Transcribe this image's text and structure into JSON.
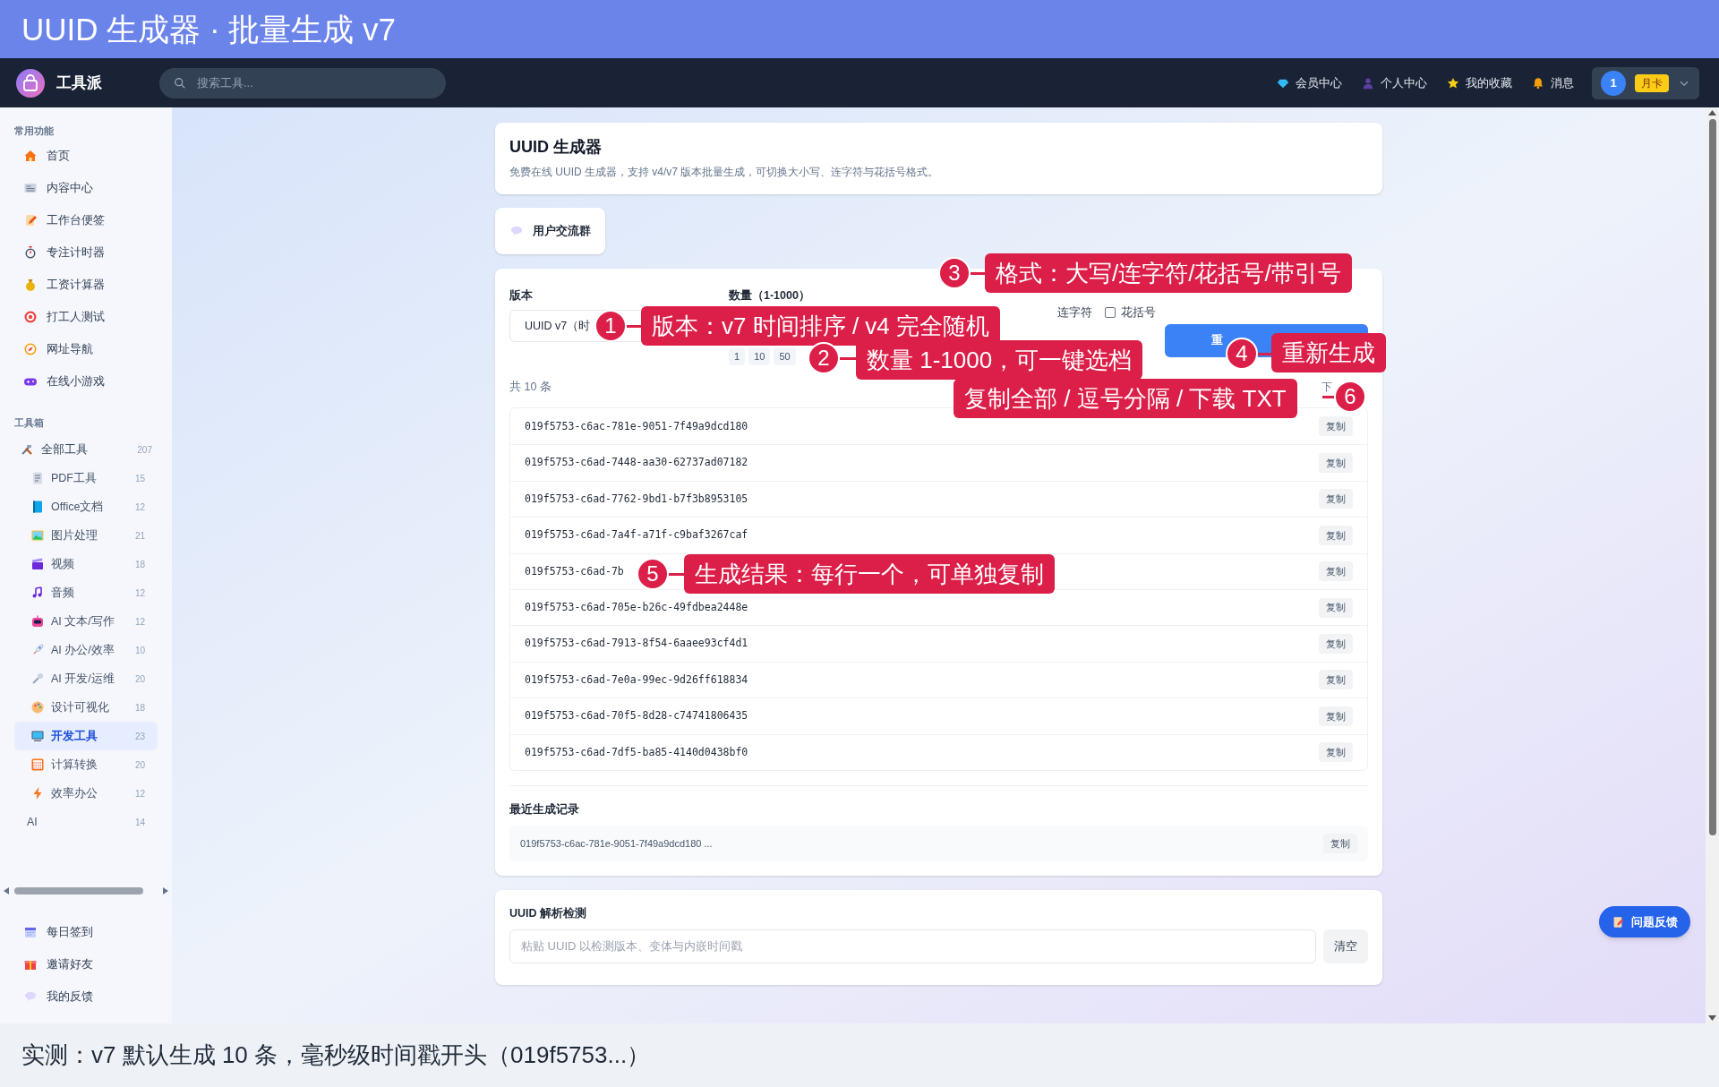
{
  "banner": {
    "title": "UUID 生成器 · 批量生成 v7"
  },
  "header": {
    "brand": "工具派",
    "search": {
      "placeholder": "搜索工具..."
    },
    "nav": [
      {
        "label": "会员中心"
      },
      {
        "label": "个人中心"
      },
      {
        "label": "我的收藏"
      },
      {
        "label": "消息"
      }
    ],
    "user": {
      "avatar": "1",
      "badge": "月卡"
    }
  },
  "sidebar": {
    "sections": [
      {
        "title": "常用功能",
        "items": [
          {
            "label": "首页",
            "selected": false
          },
          {
            "label": "内容中心",
            "selected": false
          },
          {
            "label": "工作台便签",
            "selected": false
          },
          {
            "label": "专注计时器",
            "selected": false
          },
          {
            "label": "工资计算器",
            "selected": false
          },
          {
            "label": "打工人测试",
            "selected": false
          },
          {
            "label": "网址导航",
            "selected": false
          },
          {
            "label": "在线小游戏",
            "selected": false
          }
        ]
      },
      {
        "title": "工具箱",
        "items": [
          {
            "label": "全部工具",
            "count": "207",
            "selected": false,
            "children": [
              {
                "label": "PDF工具",
                "count": "15",
                "selected": false
              },
              {
                "label": "Office文档",
                "count": "12",
                "selected": false
              },
              {
                "label": "图片处理",
                "count": "21",
                "selected": false
              },
              {
                "label": "视频",
                "count": "18",
                "selected": false
              },
              {
                "label": "音频",
                "count": "12",
                "selected": false
              },
              {
                "label": "AI 文本/写作",
                "count": "12",
                "selected": false
              },
              {
                "label": "AI 办公/效率",
                "count": "10",
                "selected": false
              },
              {
                "label": "AI 开发/运维",
                "count": "20",
                "selected": false
              },
              {
                "label": "设计可视化",
                "count": "18",
                "selected": false
              },
              {
                "label": "开发工具",
                "count": "23",
                "selected": true
              },
              {
                "label": "计算转换",
                "count": "20",
                "selected": false
              },
              {
                "label": "效率办公",
                "count": "12",
                "selected": false
              },
              {
                "label": "AI",
                "count": "14",
                "selected": false
              }
            ]
          }
        ]
      }
    ],
    "footer_items": [
      {
        "label": "每日签到"
      },
      {
        "label": "邀请好友"
      },
      {
        "label": "我的反馈"
      }
    ]
  },
  "tool_header": {
    "title": "UUID 生成器",
    "description": "免费在线 UUID 生成器，支持 v4/v7 版本批量生成，可切换大小写、连字符与花括号格式。"
  },
  "community_button": {
    "label": "用户交流群"
  },
  "generator": {
    "version": {
      "label": "版本",
      "value": "UUID v7（时"
    },
    "quantity": {
      "label": "数量（1-1000）",
      "presets": [
        "1",
        "10",
        "50"
      ]
    },
    "format_options": [
      {
        "label": "连字符"
      },
      {
        "label": "花括号",
        "checked": false
      }
    ],
    "regenerate_button": "重",
    "total": "共 10 条",
    "download_button": "下",
    "results": [
      {
        "uuid": "019f5753-c6ac-781e-9051-7f49a9dcd180",
        "copy": "复制"
      },
      {
        "uuid": "019f5753-c6ad-7448-aa30-62737ad07182",
        "copy": "复制"
      },
      {
        "uuid": "019f5753-c6ad-7762-9bd1-b7f3b8953105",
        "copy": "复制"
      },
      {
        "uuid": "019f5753-c6ad-7a4f-a71f-c9baf3267caf",
        "copy": "复制"
      },
      {
        "uuid": "019f5753-c6ad-7b",
        "copy": "复制"
      },
      {
        "uuid": "019f5753-c6ad-705e-b26c-49fdbea2448e",
        "copy": "复制"
      },
      {
        "uuid": "019f5753-c6ad-7913-8f54-6aaee93cf4d1",
        "copy": "复制"
      },
      {
        "uuid": "019f5753-c6ad-7e0a-99ec-9d26ff618834",
        "copy": "复制"
      },
      {
        "uuid": "019f5753-c6ad-70f5-8d28-c74741806435",
        "copy": "复制"
      },
      {
        "uuid": "019f5753-c6ad-7df5-ba85-4140d0438bf0",
        "copy": "复制"
      }
    ],
    "recent": {
      "title": "最近生成记录",
      "items": [
        {
          "text": "019f5753-c6ac-781e-9051-7f49a9dcd180 ...",
          "copy": "复制"
        }
      ]
    }
  },
  "parser": {
    "title": "UUID 解析检测",
    "placeholder": "粘贴 UUID 以检测版本、变体与内嵌时间戳",
    "clear_button": "清空"
  },
  "feedback_button": {
    "label": "问题反馈"
  },
  "annotations": [
    {
      "number": "1",
      "text": "版本：v7 时间排序 / v4 完全随机"
    },
    {
      "number": "2",
      "text": "数量 1-1000，可一键选档"
    },
    {
      "number": "3",
      "text": "格式：大写/连字符/花括号/带引号"
    },
    {
      "number": "4",
      "text": "重新生成"
    },
    {
      "number": "5",
      "text": "生成结果：每行一个，可单独复制"
    },
    {
      "number": "6",
      "text": "复制全部 / 逗号分隔 / 下载 TXT"
    }
  ],
  "caption": "实测：v7 默认生成 10 条，毫秒级时间戳开头（019f5753...）"
}
